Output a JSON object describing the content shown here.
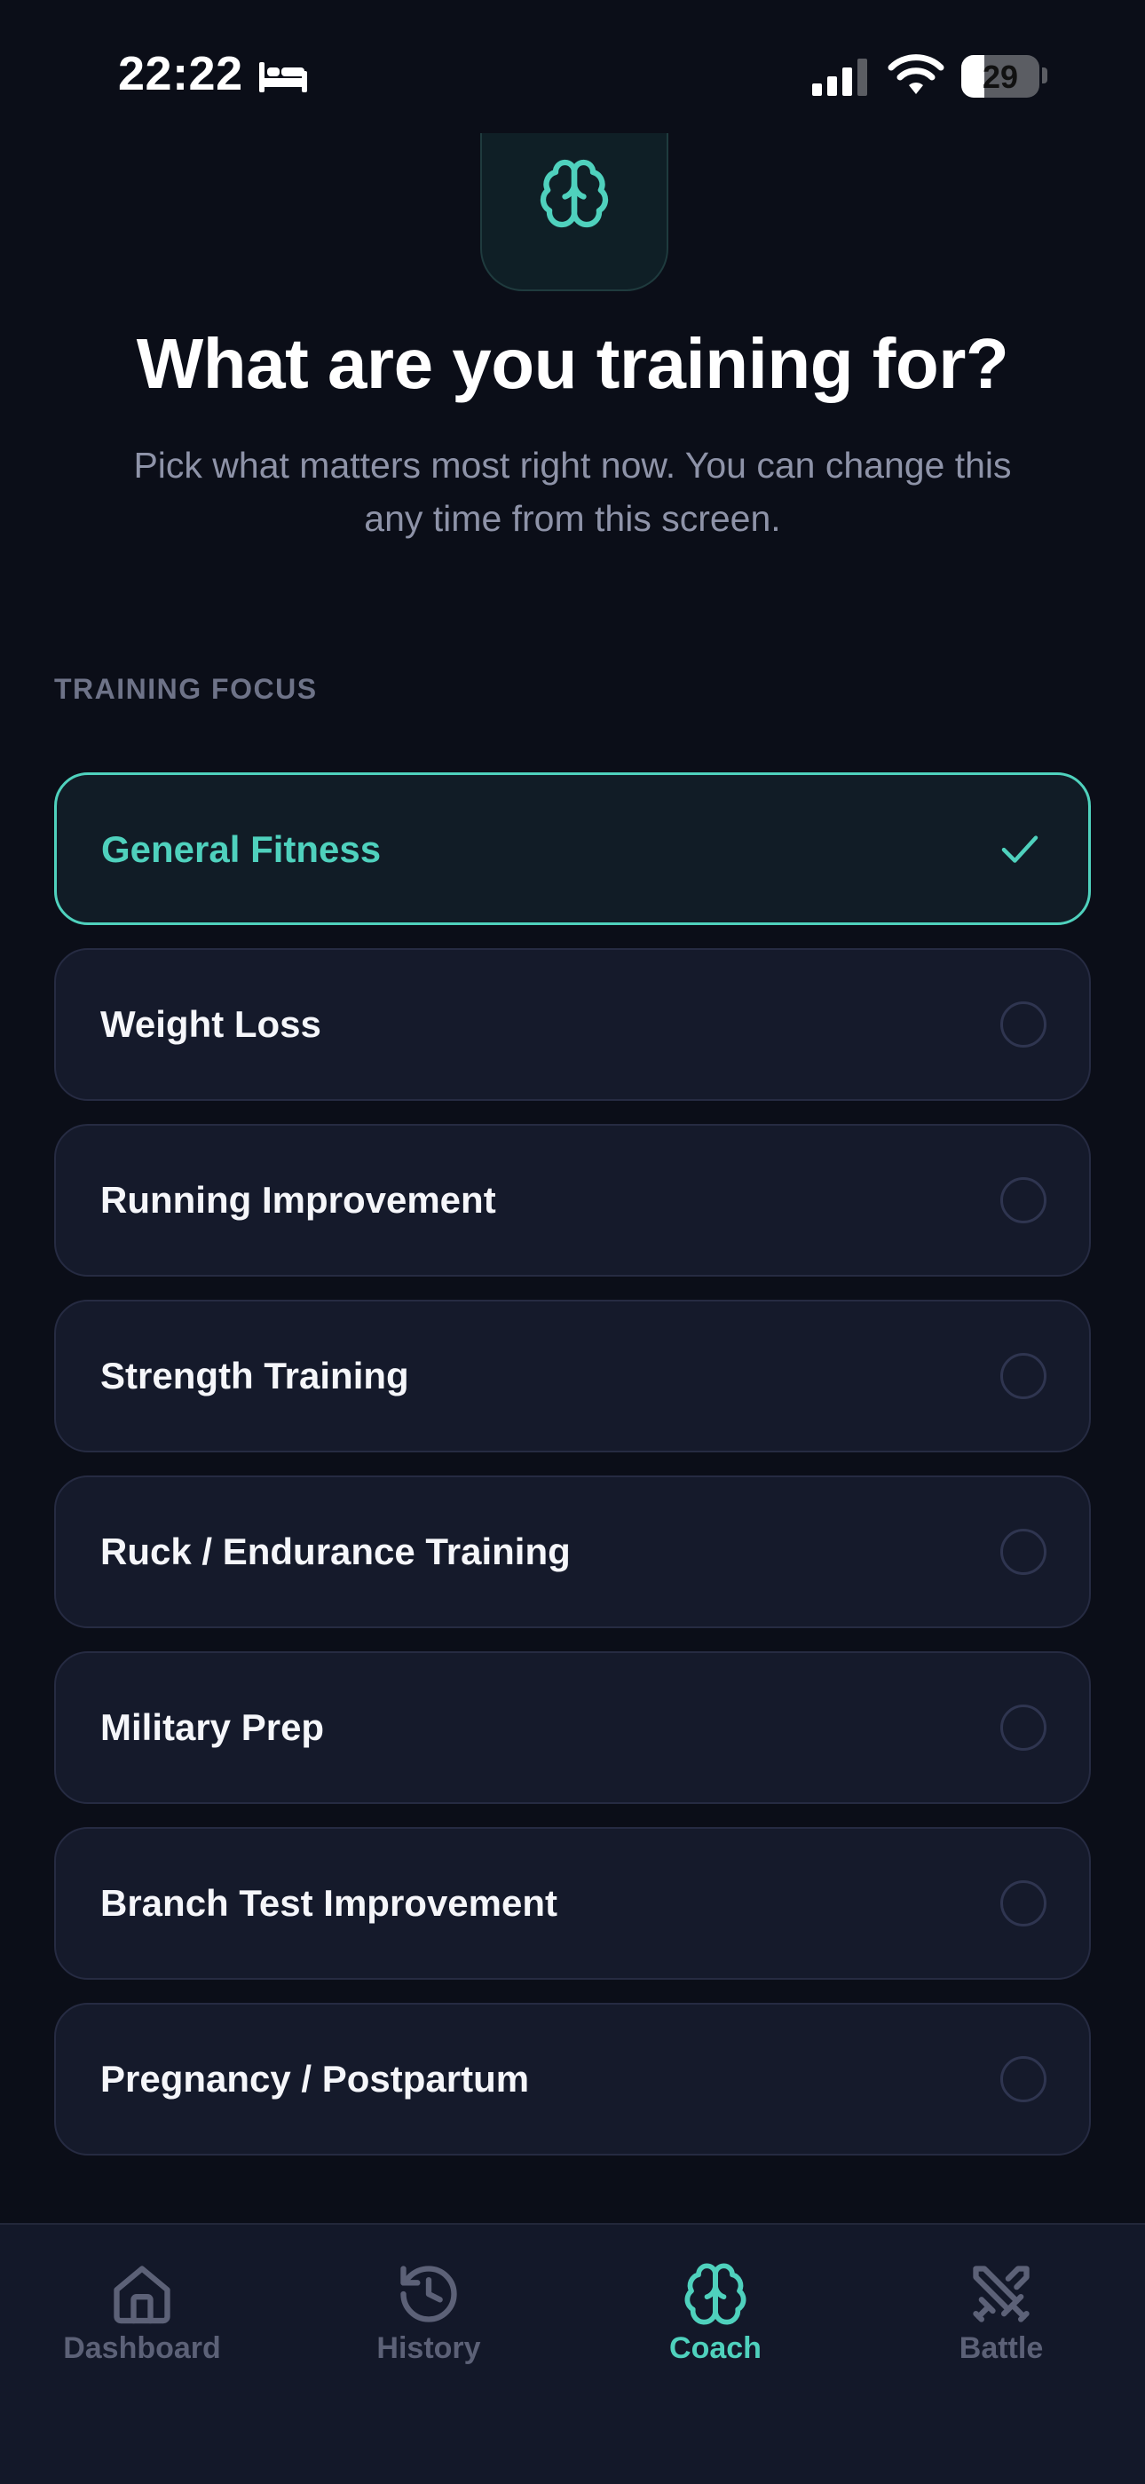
{
  "status_bar": {
    "time": "22:22",
    "battery": "29"
  },
  "header": {
    "title": "What are you training for?",
    "subtitle": "Pick what matters most right now. You can change this any time from this screen."
  },
  "section": {
    "label": "TRAINING FOCUS"
  },
  "options": [
    {
      "label": "General Fitness",
      "selected": true
    },
    {
      "label": "Weight Loss",
      "selected": false
    },
    {
      "label": "Running Improvement",
      "selected": false
    },
    {
      "label": "Strength Training",
      "selected": false
    },
    {
      "label": "Ruck / Endurance Training",
      "selected": false
    },
    {
      "label": "Military Prep",
      "selected": false
    },
    {
      "label": "Branch Test Improvement",
      "selected": false
    },
    {
      "label": "Pregnancy / Postpartum",
      "selected": false
    }
  ],
  "tab_bar": {
    "tabs": [
      {
        "label": "Dashboard",
        "icon": "home-icon",
        "active": false
      },
      {
        "label": "History",
        "icon": "history-icon",
        "active": false
      },
      {
        "label": "Coach",
        "icon": "brain-icon",
        "active": true
      },
      {
        "label": "Battle",
        "icon": "swords-icon",
        "active": false
      }
    ]
  },
  "colors": {
    "background": "#0b0e18",
    "accent": "#4fd1bd",
    "card": "#151a2b",
    "muted_text": "#8e93a8"
  }
}
